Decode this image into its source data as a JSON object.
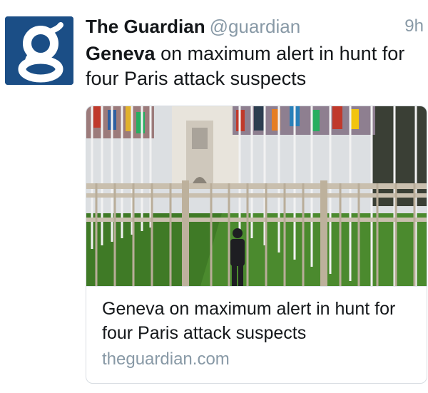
{
  "tweet": {
    "author_name": "The Guardian",
    "author_handle": "@guardian",
    "timestamp": "9h",
    "text_bold": "Geneva",
    "text_rest": " on maximum alert in hunt for four Paris attack suspects",
    "avatar_letter": "g"
  },
  "card": {
    "title": "Geneva on maximum alert in hunt for four Paris attack suspects",
    "domain": "theguardian.com"
  },
  "colors": {
    "avatar_bg": "#1b4e86",
    "muted": "#8899a6",
    "text": "#14171a",
    "grass": "#4b8a2e"
  }
}
